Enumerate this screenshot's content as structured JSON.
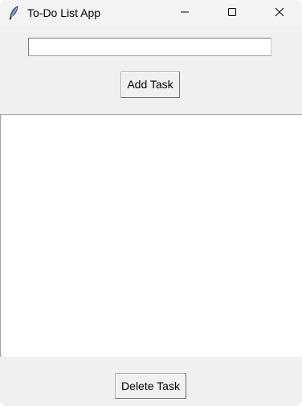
{
  "window": {
    "title": "To-Do List App",
    "icon": "feather-icon",
    "controls": [
      "minimize-icon",
      "maximize-icon",
      "close-icon"
    ]
  },
  "task_input": {
    "value": "",
    "placeholder": ""
  },
  "buttons": {
    "add_label": "Add Task",
    "delete_label": "Delete Task"
  },
  "task_list": {
    "items": []
  },
  "colors": {
    "window_bg": "#f0f0f0",
    "list_bg": "#ffffff",
    "titlebar_bg": "#f3f3f3"
  }
}
